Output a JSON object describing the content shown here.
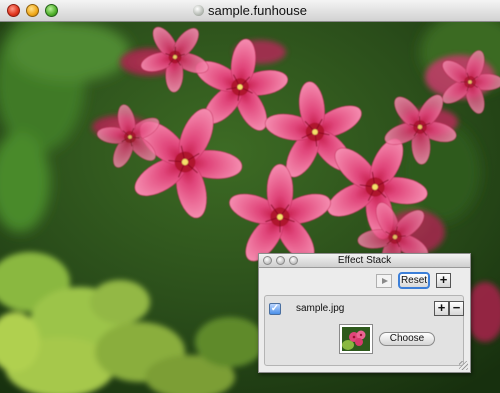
{
  "main_window": {
    "title": "sample.funhouse",
    "document_icon": "funhouse-document-icon",
    "traffic_lights": [
      "close",
      "minimize",
      "zoom"
    ],
    "content_icon": "flower-photo"
  },
  "effect_stack": {
    "title": "Effect Stack",
    "play_icon": "play-icon",
    "reset_label": "Reset",
    "add_label": "+",
    "layer": {
      "checked": true,
      "check_mark": "✓",
      "filename": "sample.jpg",
      "add_label": "+",
      "remove_label": "−",
      "choose_label": "Choose",
      "thumbnail_icon": "flower-thumbnail"
    }
  },
  "colors": {
    "petal": "#e0457a",
    "petal_light": "#f07aa0",
    "petal_center": "#b0122e",
    "foliage_dark": "#1f3d14",
    "foliage_light": "#9ac24a",
    "focus_ring": "#3c7fd8"
  }
}
